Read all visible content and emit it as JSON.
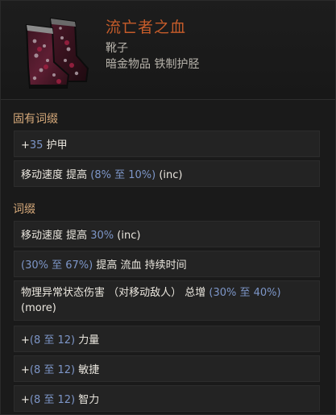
{
  "item": {
    "name": "流亡者之血",
    "type": "靴子",
    "rarity": "暗金物品 铁制护胫",
    "icon": "boots-icon"
  },
  "implicit": {
    "title": "固有词缀",
    "mods": [
      {
        "parts": [
          {
            "t": "+",
            "c": "txt"
          },
          {
            "t": "35",
            "c": "num"
          },
          {
            "t": " 护甲",
            "c": "txt"
          }
        ]
      },
      {
        "parts": [
          {
            "t": "移动速度 提高 ",
            "c": "txt"
          },
          {
            "t": "(8% 至 10%)",
            "c": "num"
          },
          {
            "t": " (inc)",
            "c": "txt"
          }
        ]
      }
    ]
  },
  "explicit": {
    "title": "词缀",
    "mods": [
      {
        "parts": [
          {
            "t": "移动速度 提高 ",
            "c": "txt"
          },
          {
            "t": "30%",
            "c": "num"
          },
          {
            "t": " (inc)",
            "c": "txt"
          }
        ]
      },
      {
        "parts": [
          {
            "t": "(30% 至 67%)",
            "c": "num"
          },
          {
            "t": " 提高 流血 持续时间",
            "c": "txt"
          }
        ]
      },
      {
        "parts": [
          {
            "t": "物理异常状态伤害 （对移动敌人） 总增 ",
            "c": "txt"
          },
          {
            "t": "(30% 至 40%)",
            "c": "num"
          },
          {
            "t": " (more)",
            "c": "txt"
          }
        ]
      },
      {
        "parts": [
          {
            "t": "+",
            "c": "txt"
          },
          {
            "t": "(8 至 12)",
            "c": "num"
          },
          {
            "t": " 力量",
            "c": "txt"
          }
        ]
      },
      {
        "parts": [
          {
            "t": "+",
            "c": "txt"
          },
          {
            "t": "(8 至 12)",
            "c": "num"
          },
          {
            "t": " 敏捷",
            "c": "txt"
          }
        ]
      },
      {
        "parts": [
          {
            "t": "+",
            "c": "txt"
          },
          {
            "t": "(8 至 12)",
            "c": "num"
          },
          {
            "t": " 智力",
            "c": "txt"
          }
        ]
      }
    ]
  },
  "colors": {
    "name": "#c65c2a",
    "section": "#d6a97a",
    "value": "#7d96c8",
    "text": "#eae6de"
  }
}
